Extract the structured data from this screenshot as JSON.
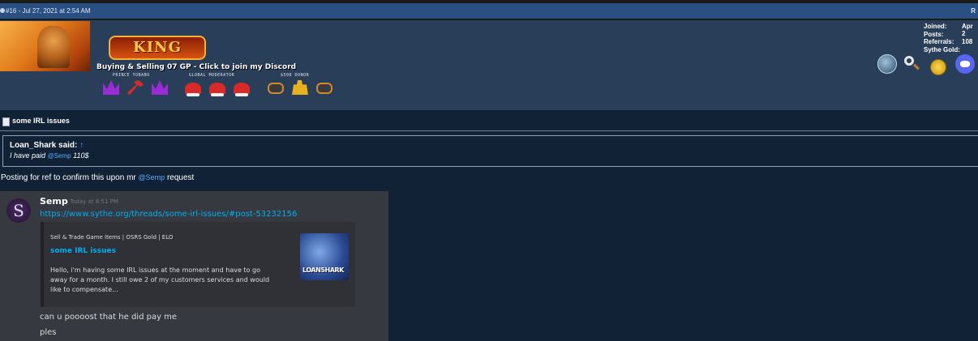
{
  "post": {
    "number_date": "#16 - Jul 27, 2021 at 2:54 AM",
    "right_letter": "R"
  },
  "user": {
    "logo_text": "KING",
    "title": "Buying & Selling 07 GP - Click to join my Discord",
    "rank_labels": [
      "PRINCE YOBABO",
      "GLOBAL MODERATOR",
      "$500 DONOR"
    ],
    "stats": {
      "joined_label": "Joined:",
      "joined_value": "Apr 2",
      "posts_label": "Posts:",
      "referrals_label": "Referrals:",
      "referrals_value": "108",
      "sythe_gold_label": "Sythe Gold:"
    }
  },
  "thread": {
    "title": "some IRL issues"
  },
  "quote": {
    "author": "Loan_Shark said:",
    "arrow": "↑",
    "text_prefix": "I have paid",
    "mention": "@Semp",
    "text_suffix": "110$"
  },
  "body": {
    "text_prefix": "Posting for ref to confirm this upon mr",
    "mention": "@Semp",
    "text_suffix": "request"
  },
  "discord": {
    "avatar_letter": "S",
    "username": "Semp",
    "timestamp": "Today at 8:51 PM",
    "link": "https://www.sythe.org/threads/some-irl-issues/#post-53232156",
    "embed": {
      "site": "Sell & Trade Game Items | OSRS Gold | ELO",
      "title": "some IRL issues",
      "desc_line1": "Hello, i'm having some IRL issues at the moment and have to go",
      "desc_line2": "away for a month. I still owe 2 of my customers services and would",
      "desc_line3": "like to compensate...",
      "thumb_text": "LOANSHARK"
    },
    "messages": [
      "can u poooost that he did pay me",
      "ples"
    ]
  }
}
